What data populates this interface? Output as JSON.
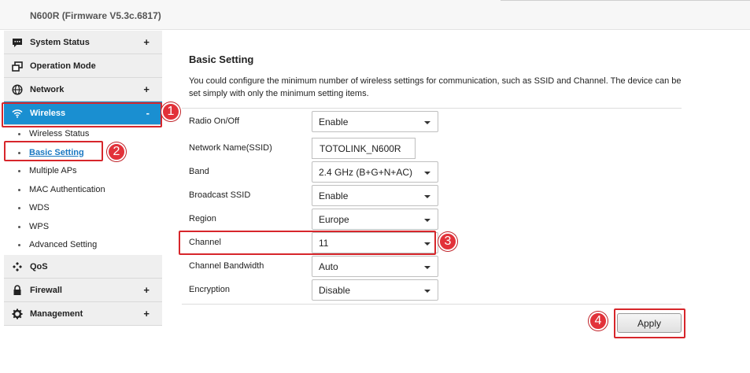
{
  "header": {
    "title": "N600R (Firmware V5.3c.6817)"
  },
  "sidebar": {
    "menus": [
      {
        "label": "System Status",
        "expand": "+"
      },
      {
        "label": "Operation Mode",
        "expand": ""
      },
      {
        "label": "Network",
        "expand": "+"
      },
      {
        "label": "Wireless",
        "expand": "-"
      },
      {
        "label": "QoS",
        "expand": ""
      },
      {
        "label": "Firewall",
        "expand": "+"
      },
      {
        "label": "Management",
        "expand": "+"
      }
    ],
    "wireless_items": [
      "Wireless Status",
      "Basic Setting",
      "Multiple APs",
      "MAC Authentication",
      "WDS",
      "WPS",
      "Advanced Setting"
    ]
  },
  "main": {
    "title": "Basic Setting",
    "description": "You could configure the minimum number of wireless settings for communication, such as SSID and Channel. The device can be set simply with only the minimum setting items.",
    "fields": {
      "radio": {
        "label": "Radio On/Off",
        "value": "Enable"
      },
      "ssid": {
        "label": "Network Name(SSID)",
        "value": "TOTOLINK_N600R"
      },
      "band": {
        "label": "Band",
        "value": "2.4 GHz (B+G+N+AC)"
      },
      "broadcast": {
        "label": "Broadcast SSID",
        "value": "Enable"
      },
      "region": {
        "label": "Region",
        "value": "Europe"
      },
      "channel": {
        "label": "Channel",
        "value": "11"
      },
      "bandwidth": {
        "label": "Channel Bandwidth",
        "value": "Auto"
      },
      "encryption": {
        "label": "Encryption",
        "value": "Disable"
      }
    },
    "apply_label": "Apply"
  },
  "annotations": [
    "1",
    "2",
    "3",
    "4"
  ],
  "colors": {
    "active_menu": "#1a8fd1",
    "highlight": "#d7262b",
    "link": "#1a78c2"
  }
}
